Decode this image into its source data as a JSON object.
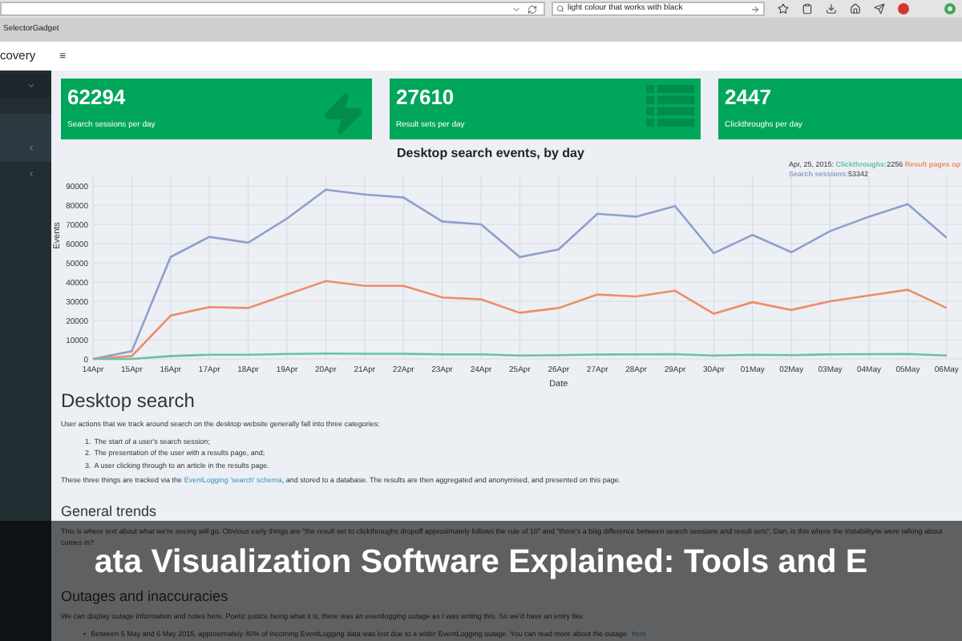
{
  "browser": {
    "search_field": {
      "value": "light colour that works with black"
    },
    "bookmarks": [
      "SelectorGadget"
    ]
  },
  "app_header": {
    "title": "covery",
    "menu_glyph": "≡"
  },
  "cards": [
    {
      "value": "62294",
      "label": "Search sessions per day",
      "kind": "bolt"
    },
    {
      "value": "27610",
      "label": "Result sets per day",
      "kind": "list"
    },
    {
      "value": "2447",
      "label": "Clickthroughs per day",
      "kind": "plain"
    }
  ],
  "chart": {
    "chart_data": {
      "type": "line",
      "title": "Desktop search events, by day",
      "xlabel": "Date",
      "ylabel": "Events",
      "categories": [
        "14Apr",
        "15Apr",
        "16Apr",
        "17Apr",
        "18Apr",
        "19Apr",
        "20Apr",
        "21Apr",
        "22Apr",
        "23Apr",
        "24Apr",
        "25Apr",
        "26Apr",
        "27Apr",
        "28Apr",
        "29Apr",
        "30Apr",
        "01May",
        "02May",
        "03May",
        "04May",
        "05May",
        "06May"
      ],
      "series": [
        {
          "color": "#8e9fcb",
          "values": [
            0,
            4000,
            53000,
            63500,
            60500,
            73000,
            88000,
            85500,
            84000,
            71500,
            70000,
            53000,
            57000,
            75500,
            74000,
            79500,
            55000,
            64500,
            55500,
            66500,
            74000,
            80500,
            63000
          ]
        },
        {
          "color": "#f08c67",
          "values": [
            0,
            1500,
            22500,
            27000,
            26500,
            33500,
            40500,
            38000,
            38000,
            32000,
            31000,
            24000,
            26500,
            33500,
            32500,
            35500,
            23500,
            29500,
            25500,
            30000,
            33000,
            36000,
            26500
          ]
        },
        {
          "color": "#66c2a5",
          "values": [
            0,
            0,
            1500,
            2200,
            2200,
            2600,
            2800,
            2700,
            2700,
            2400,
            2400,
            1800,
            2000,
            2300,
            2400,
            2500,
            1800,
            2200,
            2000,
            2400,
            2500,
            2600,
            1800
          ]
        }
      ],
      "yticks": [
        0,
        10000,
        20000,
        30000,
        40000,
        50000,
        60000,
        70000,
        80000,
        90000
      ],
      "ylim": [
        0,
        95000
      ],
      "grid": true
    },
    "hover_label": {
      "date": "Apr, 25, 2015:",
      "entries": [
        {
          "name": "Clickthroughs:",
          "value": "2256",
          "color": "#66c2a5"
        },
        {
          "name": "Result pages op",
          "color": "#f08c67"
        },
        {
          "name": "Search sessions:",
          "value": "53342",
          "color": "#8e9fcb"
        }
      ]
    }
  },
  "content": {
    "heading": "Desktop search",
    "intro": "User actions that we track around search on the desktop website generally fall into three categories:",
    "list": [
      {
        "number": "1.",
        "text": "The start of a user's search session;"
      },
      {
        "number": "2.",
        "text": "The presentation of the user with a results page, and;"
      },
      {
        "number": "3.",
        "text": "A user clicking through to an article in the results page."
      }
    ],
    "tracking": {
      "before": "These three things are tracked via the",
      "link": "EventLogging 'search' schema",
      "after": ", and stored to a database. The results are then aggregated and anonymised, and presented on this page."
    },
    "heading_2": "General trends",
    "trends": "This is where text about what we're seeing will go. Obvious early things are \"the result set to clickthroughs dropoff approximately follows the rule of 10\" and \"there's a biiig difference between search sessions and result sets\". Dan, is this where the instability/w were talking about comes in?",
    "heading_3": "Outages and inaccuracies",
    "outages": "We can display outage information and notes here. Poetic justice being what it is, there was an eventlogging outage as I was writing this. So we'd have an entry like:",
    "outage_item": {
      "bullet": "•",
      "text": "Between 5 May and 6 May 2015, approximately 40% of incoming EventLogging data was lost due to a wider EventLogging outage. You can read more about the outage",
      "link": "here"
    }
  },
  "banner": {
    "title": "ata Visualization Software Explained: Tools and E"
  }
}
